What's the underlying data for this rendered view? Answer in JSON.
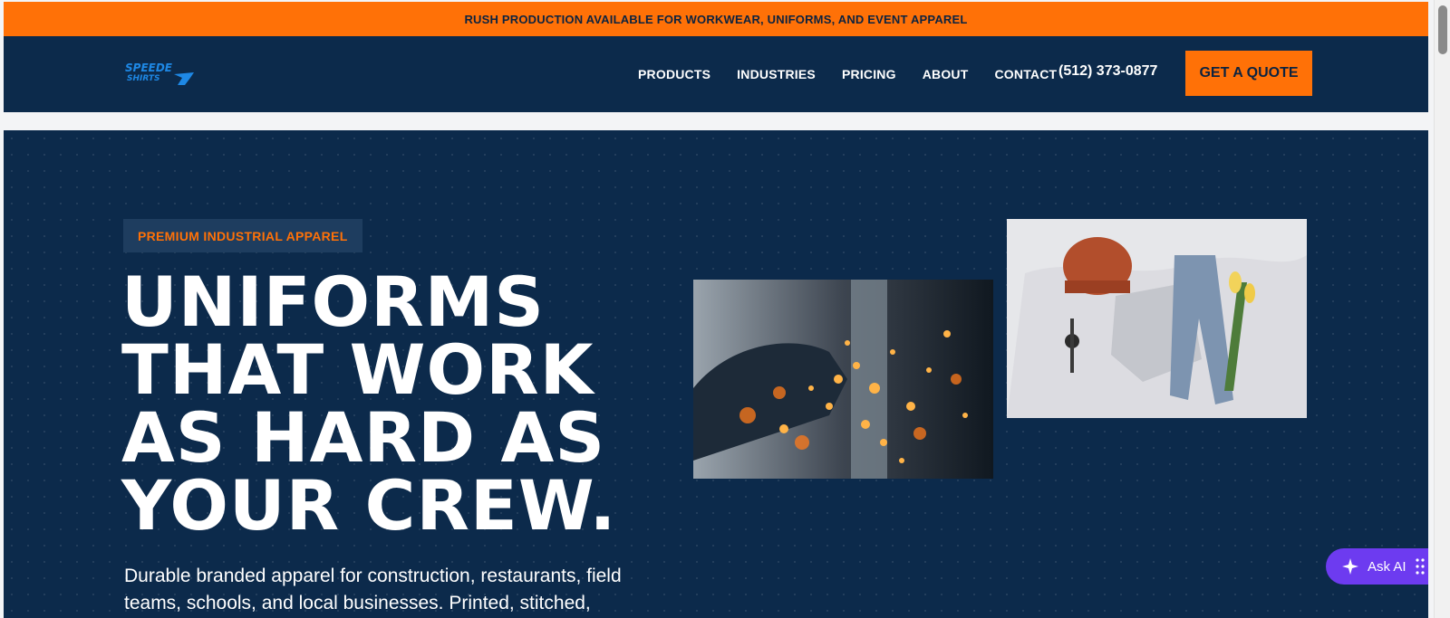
{
  "announcement": "RUSH PRODUCTION AVAILABLE FOR WORKWEAR, UNIFORMS, AND EVENT APPAREL",
  "header": {
    "logo_text": [
      "SPEEDE",
      "SHIRTS"
    ],
    "nav": [
      "PRODUCTS",
      "INDUSTRIES",
      "PRICING",
      "ABOUT",
      "CONTACT"
    ],
    "phone": "(512) 373-0877",
    "cta": "GET A QUOTE"
  },
  "hero": {
    "badge": "PREMIUM INDUSTRIAL APPAREL",
    "headline_lines": [
      "UNIFORMS",
      "THAT WORK",
      "AS HARD AS",
      "YOUR CREW."
    ],
    "lede": "Durable branded apparel for construction, restaurants, field teams, schools, and local businesses. Printed, stitched, proofed"
  },
  "widgets": {
    "ask_ai": "Ask AI"
  },
  "colors": {
    "accent": "#ff7107",
    "navy": "#0c2a4b",
    "ask_ai_purple": "#6d3bf0"
  }
}
